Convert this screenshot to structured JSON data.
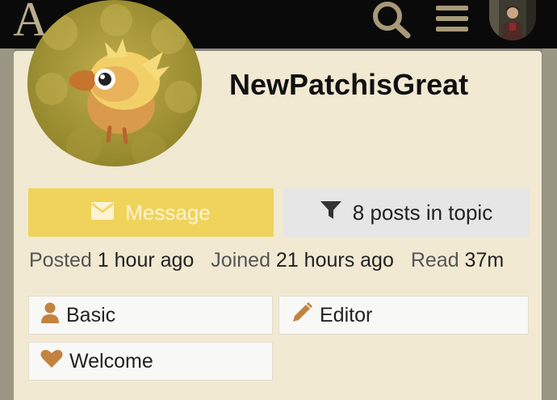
{
  "header": {
    "logo_letter": "A",
    "search_icon": "search-icon",
    "menu_icon": "hamburger-menu-icon",
    "avatar_icon": "user-avatar"
  },
  "profile": {
    "username": "NewPatchisGreat",
    "avatar": "chocobo-chick-avatar"
  },
  "actions": {
    "message_label": "Message",
    "filter_label": "8 posts in topic"
  },
  "stats": {
    "posted_label": "Posted",
    "posted_value": "1 hour ago",
    "joined_label": "Joined",
    "joined_value": "21 hours ago",
    "read_label": "Read",
    "read_value": "37m"
  },
  "badges": [
    {
      "label": "Basic",
      "icon": "user-icon"
    },
    {
      "label": "Editor",
      "icon": "pencil-icon"
    },
    {
      "label": "Welcome",
      "icon": "heart-icon"
    }
  ],
  "colors": {
    "card_bg": "#f1e9d2",
    "message_bg": "#f0d35b",
    "badge_icon": "#c2833f",
    "topbar_bg": "#0a0a0a"
  }
}
